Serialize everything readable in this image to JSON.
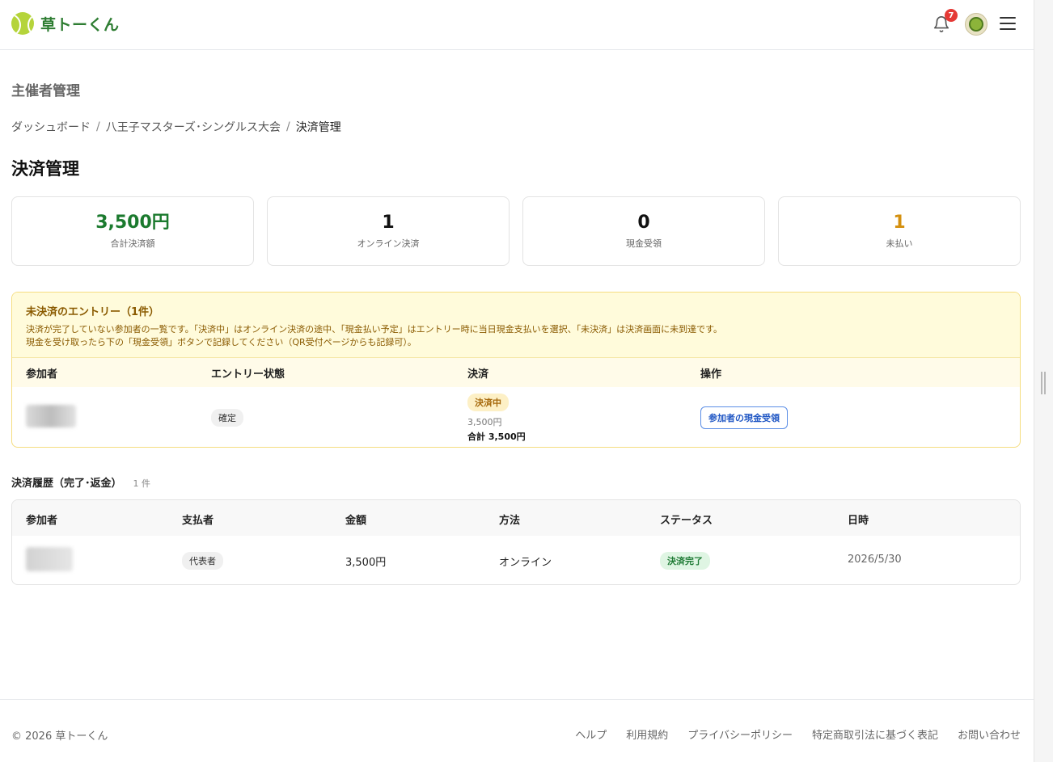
{
  "brand": {
    "name": "草トーくん"
  },
  "header": {
    "notification_count": "7"
  },
  "section_title": "主催者管理",
  "breadcrumb": [
    {
      "label": "ダッシュボード"
    },
    {
      "label": "八王子マスターズ･シングルス大会"
    },
    {
      "label": "決済管理"
    }
  ],
  "page_title": "決済管理",
  "stats": [
    {
      "value": "3,500円",
      "label": "合計決済額",
      "color": "#1b7a2e"
    },
    {
      "value": "1",
      "label": "オンライン決済",
      "color": "#111111"
    },
    {
      "value": "0",
      "label": "現金受領",
      "color": "#111111"
    },
    {
      "value": "1",
      "label": "未払い",
      "color": "#d4900f"
    }
  ],
  "unpaid": {
    "title": "未決済のエントリー（1件）",
    "desc_line1": "決済が完了していない参加者の一覧です。「決済中」はオンライン決済の途中、「現金払い予定」はエントリー時に当日現金支払いを選択、「未決済」は決済画面に未到達です。",
    "desc_line2": "現金を受け取ったら下の「現金受領」ボタンで記録してください（QR受付ページからも記録可）。",
    "columns": [
      "参加者",
      "エントリー状態",
      "決済",
      "操作"
    ],
    "rows": [
      {
        "entry_status": "確定",
        "payment_status": "決済中",
        "amount": "3,500円",
        "total": "合計 3,500円",
        "action": "参加者の現金受領"
      }
    ]
  },
  "history": {
    "title": "決済履歴（完了･返金）",
    "count": "1 件",
    "columns": [
      "参加者",
      "支払者",
      "金額",
      "方法",
      "ステータス",
      "日時"
    ],
    "rows": [
      {
        "payer": "代表者",
        "amount": "3,500円",
        "method": "オンライン",
        "status": "決済完了",
        "date": "2026/5/30"
      }
    ]
  },
  "footer": {
    "copyright": "© 2026 草トーくん",
    "links": [
      "ヘルプ",
      "利用規約",
      "プライバシーポリシー",
      "特定商取引法に基づく表記",
      "お問い合わせ"
    ]
  }
}
